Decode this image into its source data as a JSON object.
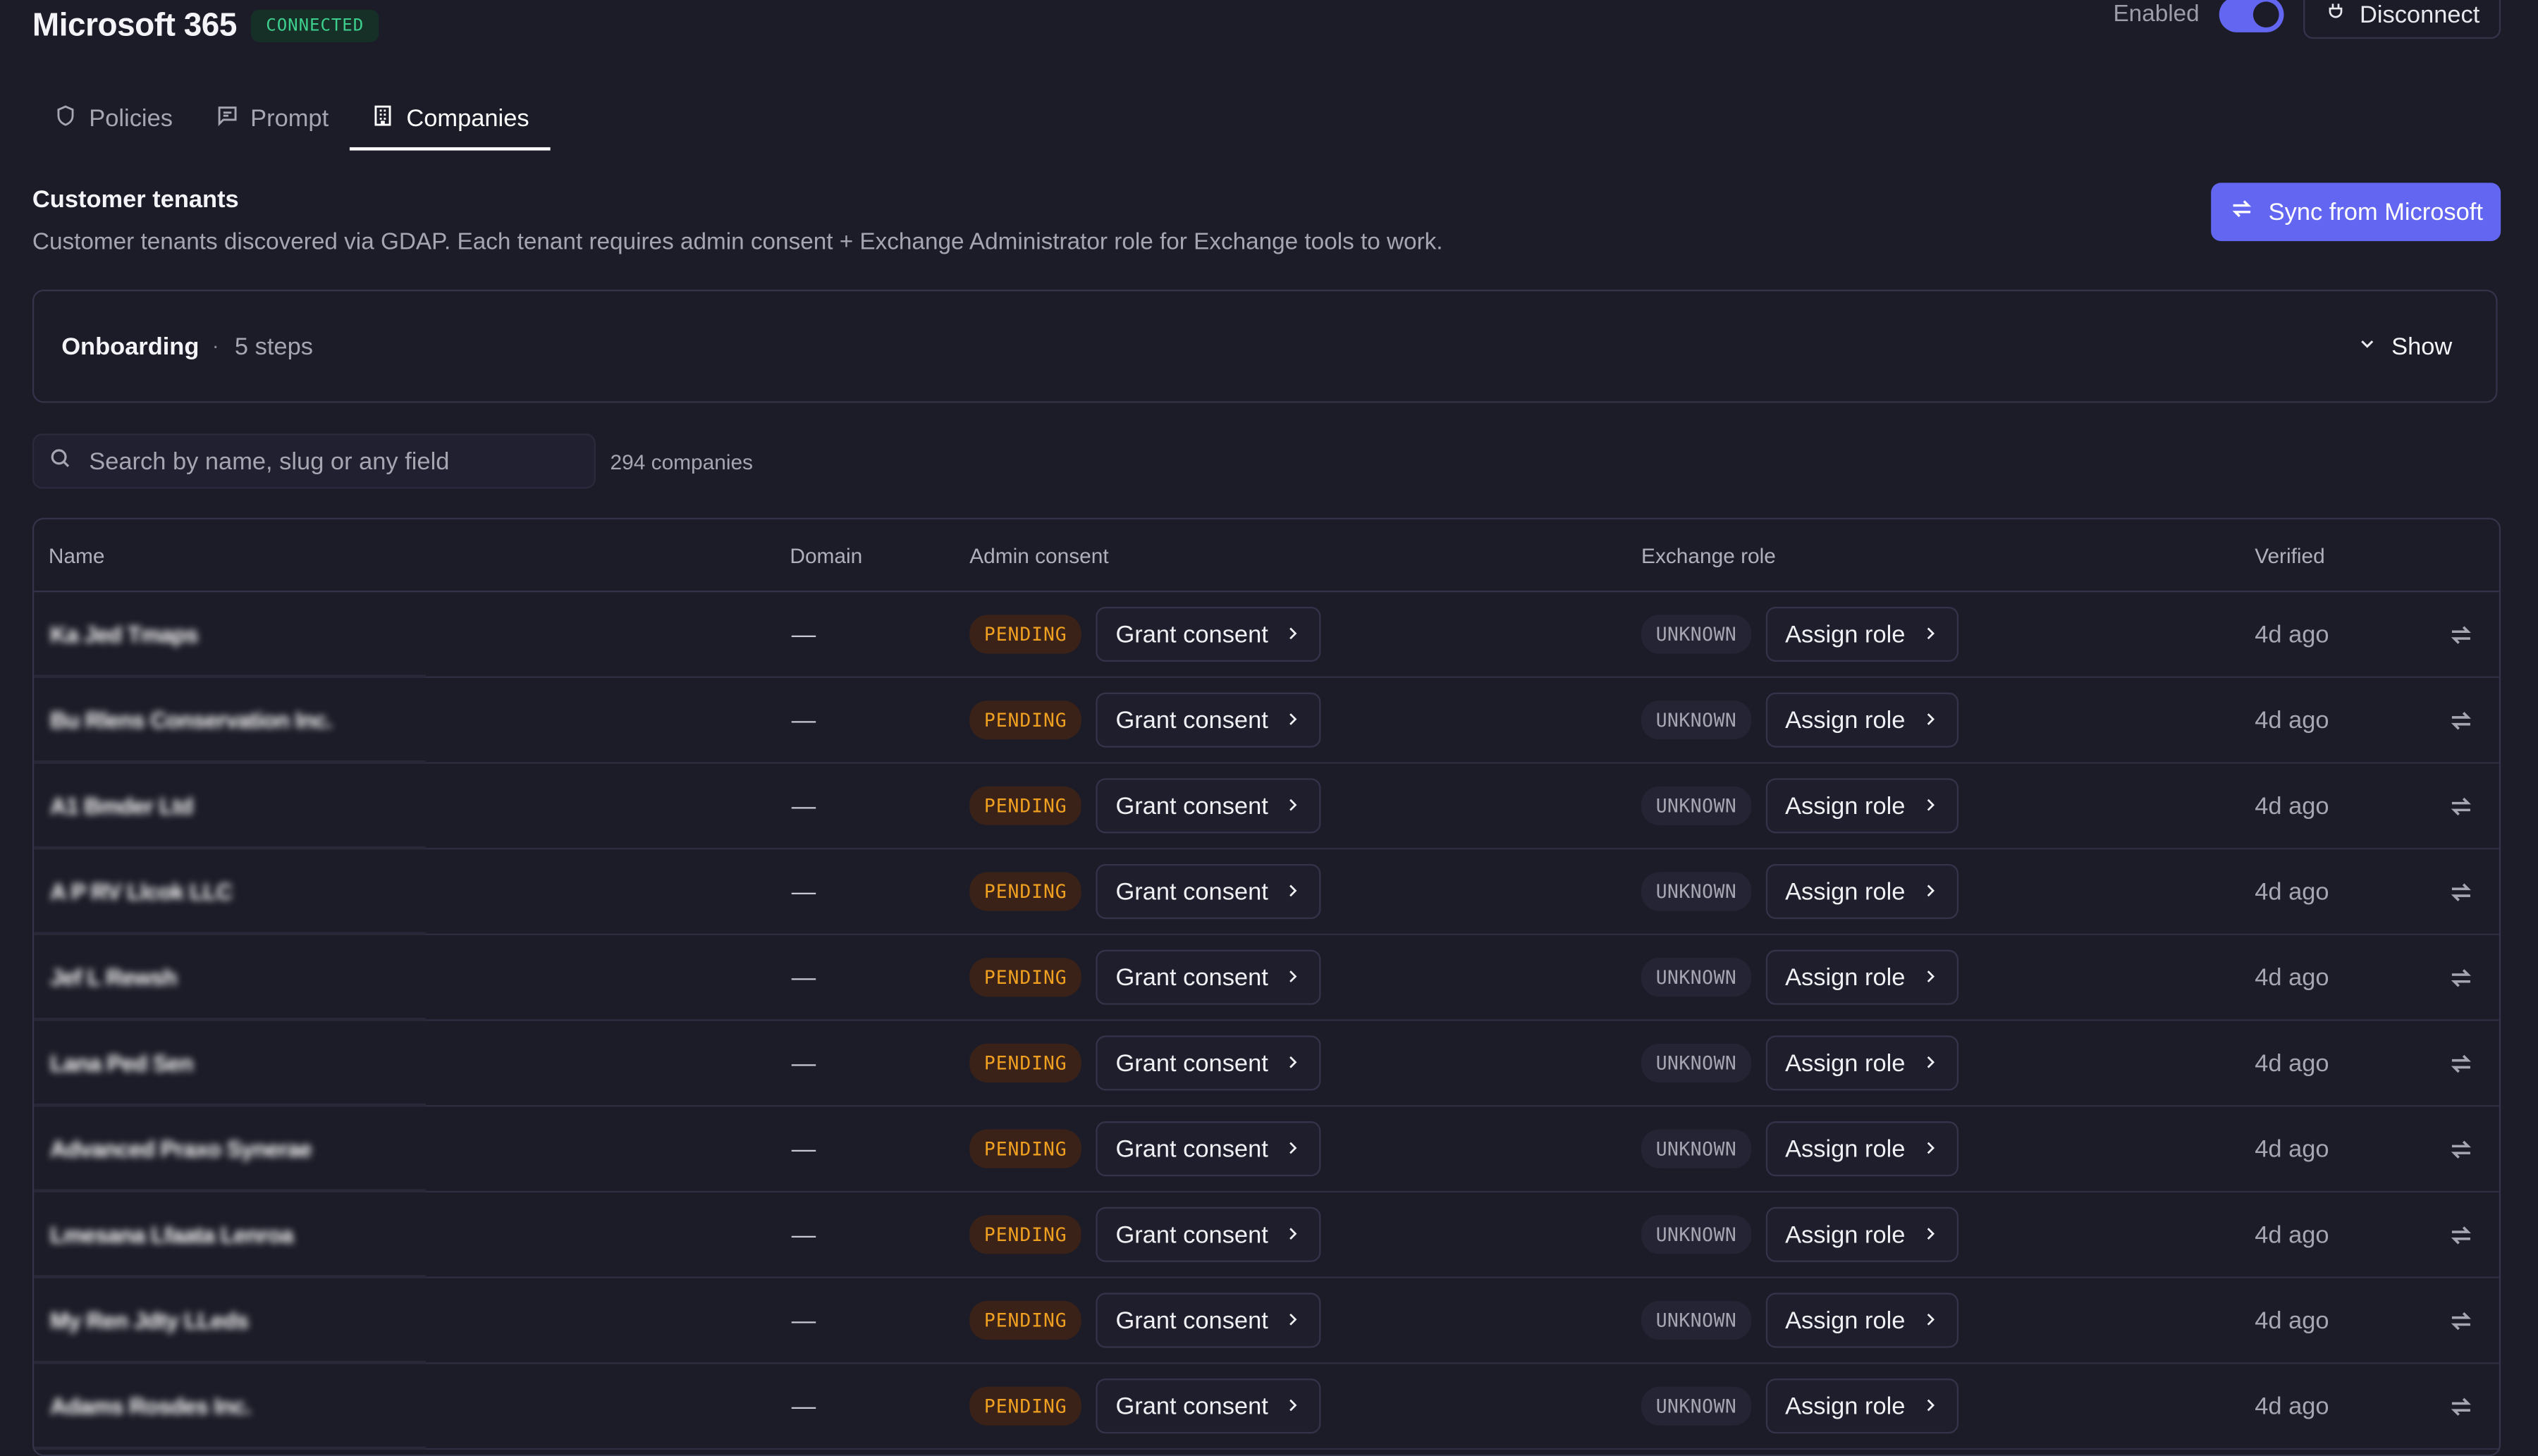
{
  "header": {
    "app_title": "Microsoft 365",
    "status_badge": "CONNECTED",
    "enabled_label": "Enabled",
    "enabled": true,
    "disconnect_label": "Disconnect"
  },
  "tabs": [
    {
      "label": "Policies",
      "icon": "shield-icon",
      "active": false
    },
    {
      "label": "Prompt",
      "icon": "message-icon",
      "active": false
    },
    {
      "label": "Companies",
      "icon": "building-icon",
      "active": true
    }
  ],
  "section": {
    "title": "Customer tenants",
    "description": "Customer tenants discovered via GDAP. Each tenant requires admin consent + Exchange Administrator role for Exchange tools to work.",
    "sync_button": "Sync from Microsoft"
  },
  "onboarding": {
    "title": "Onboarding",
    "separator": "·",
    "steps": "5 steps",
    "toggle_label": "Show"
  },
  "search": {
    "placeholder": "Search by name, slug or any field",
    "count": "294 companies"
  },
  "table": {
    "columns": [
      "Name",
      "Domain",
      "Admin consent",
      "Exchange role",
      "Verified"
    ],
    "rows": [
      {
        "name": "Ka Jed Tmaps",
        "domain": "—",
        "consent_status": "PENDING",
        "consent_action": "Grant consent",
        "role_status": "UNKNOWN",
        "role_action": "Assign role",
        "verified": "4d ago"
      },
      {
        "name": "Bu Rlens Conservation Inc.",
        "domain": "—",
        "consent_status": "PENDING",
        "consent_action": "Grant consent",
        "role_status": "UNKNOWN",
        "role_action": "Assign role",
        "verified": "4d ago"
      },
      {
        "name": "A1 Bmder Ltd",
        "domain": "—",
        "consent_status": "PENDING",
        "consent_action": "Grant consent",
        "role_status": "UNKNOWN",
        "role_action": "Assign role",
        "verified": "4d ago"
      },
      {
        "name": "A P RV Llcok LLC",
        "domain": "—",
        "consent_status": "PENDING",
        "consent_action": "Grant consent",
        "role_status": "UNKNOWN",
        "role_action": "Assign role",
        "verified": "4d ago"
      },
      {
        "name": "Jef L Rewsh",
        "domain": "—",
        "consent_status": "PENDING",
        "consent_action": "Grant consent",
        "role_status": "UNKNOWN",
        "role_action": "Assign role",
        "verified": "4d ago"
      },
      {
        "name": "Lana Ped Sen",
        "domain": "—",
        "consent_status": "PENDING",
        "consent_action": "Grant consent",
        "role_status": "UNKNOWN",
        "role_action": "Assign role",
        "verified": "4d ago"
      },
      {
        "name": "Advanced Praxo Synerae",
        "domain": "—",
        "consent_status": "PENDING",
        "consent_action": "Grant consent",
        "role_status": "UNKNOWN",
        "role_action": "Assign role",
        "verified": "4d ago"
      },
      {
        "name": "Lmesana Lfaata Lenroa",
        "domain": "—",
        "consent_status": "PENDING",
        "consent_action": "Grant consent",
        "role_status": "UNKNOWN",
        "role_action": "Assign role",
        "verified": "4d ago"
      },
      {
        "name": "My Ren Jdty LLeds",
        "domain": "—",
        "consent_status": "PENDING",
        "consent_action": "Grant consent",
        "role_status": "UNKNOWN",
        "role_action": "Assign role",
        "verified": "4d ago"
      },
      {
        "name": "Adams Rosdes Inc.",
        "domain": "—",
        "consent_status": "PENDING",
        "consent_action": "Grant consent",
        "role_status": "UNKNOWN",
        "role_action": "Assign role",
        "verified": "4d ago"
      }
    ]
  },
  "colors": {
    "background": "#1c1c28",
    "accent": "#6366f1",
    "connected": "#3ecf8e",
    "pending": "#f0a020"
  }
}
